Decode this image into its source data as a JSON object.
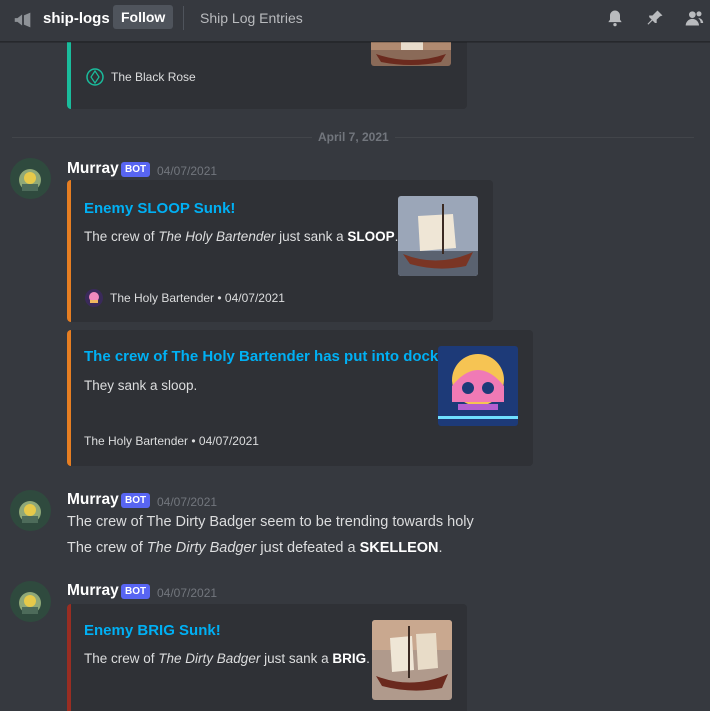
{
  "header": {
    "channel_icon": "megaphone-icon",
    "channel_name": "ship-logs",
    "follow_label": "Follow",
    "topic": "Ship Log Entries",
    "right_icons": [
      "bell-icon",
      "pin-icon",
      "members-icon"
    ]
  },
  "top_embed": {
    "footer_text": "The Black Rose",
    "accent": "#1abc9c"
  },
  "date_divider": "April 7, 2021",
  "messages": [
    {
      "author": "Murray",
      "bot_tag": "BOT",
      "timestamp": "04/07/2021",
      "embeds": [
        {
          "title": "Enemy SLOOP Sunk!",
          "desc_prefix": "The crew of ",
          "desc_italic": "The Holy Bartender",
          "desc_mid": " just sank a ",
          "desc_bold": "SLOOP",
          "desc_suffix": ".",
          "footer": "The Holy Bartender • 04/07/2021",
          "accent": "#e67e22"
        },
        {
          "title": "The crew of The Holy Bartender has put into dock!",
          "description": "They sank a sloop.",
          "footer": "The Holy Bartender • 04/07/2021",
          "accent": "#e67e22"
        }
      ]
    },
    {
      "author": "Murray",
      "bot_tag": "BOT",
      "timestamp": "04/07/2021",
      "line1": "The crew of The Dirty Badger seem to be trending towards holy",
      "line2_prefix": "The crew of ",
      "line2_italic": "The Dirty Badger",
      "line2_mid": " just defeated a ",
      "line2_bold": "SKELLEON",
      "line2_suffix": "."
    },
    {
      "author": "Murray",
      "bot_tag": "BOT",
      "timestamp": "04/07/2021",
      "embeds": [
        {
          "title": "Enemy BRIG Sunk!",
          "desc_prefix": "The crew of ",
          "desc_italic": "The Dirty Badger",
          "desc_mid": " just sank a ",
          "desc_bold": "BRIG",
          "desc_suffix": ".",
          "accent": "#992d22"
        }
      ]
    }
  ]
}
